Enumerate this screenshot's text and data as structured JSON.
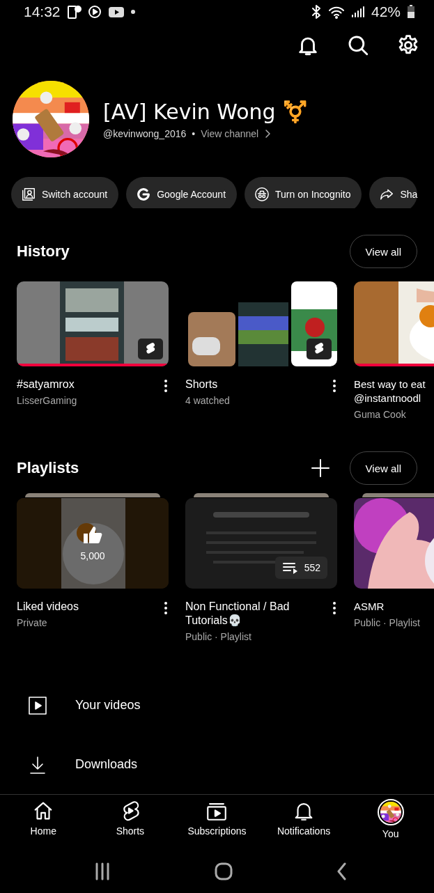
{
  "status_bar": {
    "time": "14:32",
    "battery": "42%"
  },
  "profile": {
    "name": "[AV] Kevin Wong ⚧️",
    "handle": "@kevinwong_2016",
    "separator": "•",
    "link": "View channel"
  },
  "chips": [
    {
      "kind": "switch",
      "label": "Switch account"
    },
    {
      "kind": "google",
      "label": "Google Account"
    },
    {
      "kind": "incognito",
      "label": "Turn on Incognito"
    },
    {
      "kind": "share",
      "label": "Sha"
    }
  ],
  "history": {
    "title": "History",
    "button": "View all",
    "items": [
      {
        "kind": "short",
        "title": "#satyamrox",
        "subtitle": "LisserGaming",
        "level": 1,
        "menu": true
      },
      {
        "kind": "shorts_stack",
        "title": "Shorts",
        "subtitle": "4 watched",
        "menu": true
      },
      {
        "kind": "video",
        "title": "Best way to eat @instantnoodl",
        "subtitle": "Guma Cook",
        "level": 1,
        "menu": false
      }
    ]
  },
  "playlists": {
    "title": "Playlists",
    "button": "View all",
    "items": [
      {
        "kind": "liked",
        "title": "Liked videos",
        "subtitle": "Private",
        "count": "5,000",
        "menu": true
      },
      {
        "kind": "playlist",
        "title": "Non Functional / Bad Tutorials💀",
        "subtitle": "Public · Playlist",
        "count": "552",
        "menu": true
      },
      {
        "kind": "asmr",
        "title": "ASMR",
        "subtitle": "Public · Playlist",
        "menu": false
      }
    ]
  },
  "menu": [
    {
      "kind": "videos",
      "label": "Your videos"
    },
    {
      "kind": "downloads",
      "label": "Downloads"
    }
  ],
  "bottom_nav": [
    {
      "kind": "home",
      "label": "Home",
      "selected": false
    },
    {
      "kind": "shorts",
      "label": "Shorts",
      "selected": false
    },
    {
      "kind": "subscriptions",
      "label": "Subscriptions",
      "selected": false
    },
    {
      "kind": "notifications",
      "label": "Notifications",
      "selected": false
    },
    {
      "kind": "you",
      "label": "You",
      "selected": true
    }
  ]
}
